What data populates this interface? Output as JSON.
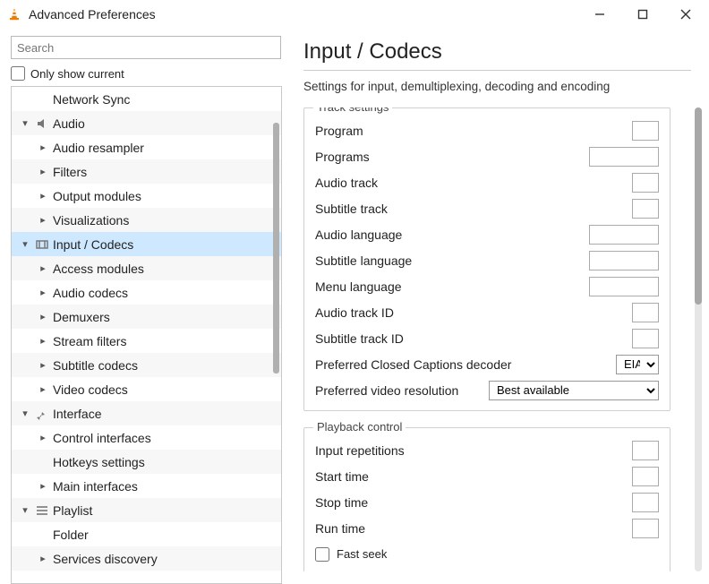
{
  "window": {
    "title": "Advanced Preferences"
  },
  "search": {
    "placeholder": "Search"
  },
  "only_show": {
    "label": "Only show current",
    "checked": false
  },
  "tree": [
    {
      "label": "Network Sync",
      "depth": 2,
      "expand": "",
      "icon": ""
    },
    {
      "label": "Audio",
      "depth": 1,
      "expand": "down",
      "icon": "audio"
    },
    {
      "label": "Audio resampler",
      "depth": 2,
      "expand": "right",
      "icon": ""
    },
    {
      "label": "Filters",
      "depth": 2,
      "expand": "right",
      "icon": ""
    },
    {
      "label": "Output modules",
      "depth": 2,
      "expand": "right",
      "icon": ""
    },
    {
      "label": "Visualizations",
      "depth": 2,
      "expand": "right",
      "icon": ""
    },
    {
      "label": "Input / Codecs",
      "depth": 1,
      "expand": "down",
      "icon": "codec",
      "selected": true
    },
    {
      "label": "Access modules",
      "depth": 2,
      "expand": "right",
      "icon": ""
    },
    {
      "label": "Audio codecs",
      "depth": 2,
      "expand": "right",
      "icon": ""
    },
    {
      "label": "Demuxers",
      "depth": 2,
      "expand": "right",
      "icon": ""
    },
    {
      "label": "Stream filters",
      "depth": 2,
      "expand": "right",
      "icon": ""
    },
    {
      "label": "Subtitle codecs",
      "depth": 2,
      "expand": "right",
      "icon": ""
    },
    {
      "label": "Video codecs",
      "depth": 2,
      "expand": "right",
      "icon": ""
    },
    {
      "label": "Interface",
      "depth": 1,
      "expand": "down",
      "icon": "interface"
    },
    {
      "label": "Control interfaces",
      "depth": 2,
      "expand": "right",
      "icon": ""
    },
    {
      "label": "Hotkeys settings",
      "depth": 2,
      "expand": "",
      "icon": ""
    },
    {
      "label": "Main interfaces",
      "depth": 2,
      "expand": "right",
      "icon": ""
    },
    {
      "label": "Playlist",
      "depth": 1,
      "expand": "down",
      "icon": "playlist"
    },
    {
      "label": "Folder",
      "depth": 2,
      "expand": "",
      "icon": ""
    },
    {
      "label": "Services discovery",
      "depth": 2,
      "expand": "right",
      "icon": ""
    }
  ],
  "panel": {
    "title": "Input / Codecs",
    "subtitle": "Settings for input, demultiplexing, decoding and encoding",
    "groups": [
      {
        "legend": "Track settings",
        "rows": [
          {
            "label": "Program",
            "kind": "num",
            "w": "w30",
            "value": ""
          },
          {
            "label": "Programs",
            "kind": "text",
            "w": "w78",
            "value": ""
          },
          {
            "label": "Audio track",
            "kind": "num",
            "w": "w30",
            "value": ""
          },
          {
            "label": "Subtitle track",
            "kind": "num",
            "w": "w30",
            "value": ""
          },
          {
            "label": "Audio language",
            "kind": "text",
            "w": "w78",
            "value": ""
          },
          {
            "label": "Subtitle language",
            "kind": "text",
            "w": "w78",
            "value": ""
          },
          {
            "label": "Menu language",
            "kind": "text",
            "w": "w78",
            "value": ""
          },
          {
            "label": "Audio track ID",
            "kind": "num",
            "w": "w30",
            "value": ""
          },
          {
            "label": "Subtitle track ID",
            "kind": "num",
            "w": "w30",
            "value": ""
          },
          {
            "label": "Preferred Closed Captions decoder",
            "kind": "select",
            "w": "w48",
            "value": "EIA/CE"
          },
          {
            "label": "Preferred video resolution",
            "kind": "select",
            "w": "w190",
            "value": "Best available"
          }
        ]
      },
      {
        "legend": "Playback control",
        "rows": [
          {
            "label": "Input repetitions",
            "kind": "num",
            "w": "w30",
            "value": ""
          },
          {
            "label": "Start time",
            "kind": "num",
            "w": "w30",
            "value": ""
          },
          {
            "label": "Stop time",
            "kind": "num",
            "w": "w30",
            "value": ""
          },
          {
            "label": "Run time",
            "kind": "num",
            "w": "w30",
            "value": ""
          },
          {
            "label": "Fast seek",
            "kind": "check",
            "checked": false
          }
        ]
      }
    ]
  }
}
